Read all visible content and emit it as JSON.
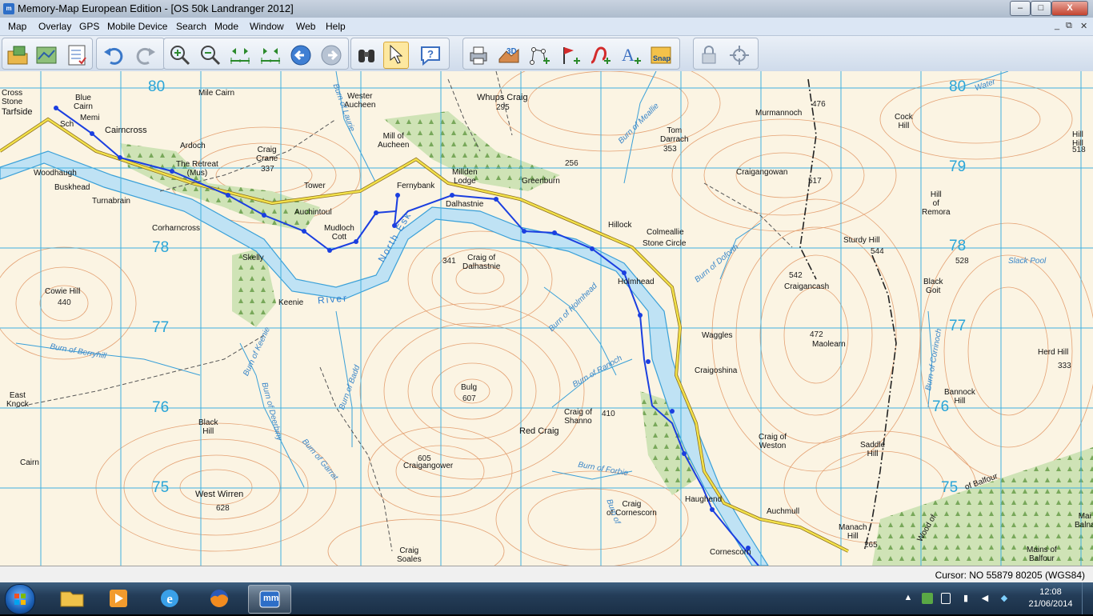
{
  "window": {
    "title": "Memory-Map European Edition - [OS 50k Landranger 2012]",
    "app_icon_text": "m",
    "minimize": "–",
    "maximize": "□",
    "close": "X"
  },
  "menu": {
    "items": [
      "Map",
      "Overlay",
      "GPS",
      "Mobile Device",
      "Search",
      "Mode",
      "Window",
      "Web",
      "Help"
    ],
    "mdi_minimize": "_",
    "mdi_restore": "⧉",
    "mdi_close": "✕"
  },
  "map": {
    "grid_eastings_labels": [
      "80",
      "79",
      "78",
      "77",
      "76",
      "75"
    ],
    "grid_labels_left": [
      "80",
      "78",
      "77",
      "76",
      "75"
    ],
    "grid_labels_right": [
      "80",
      "79",
      "78",
      "77",
      "76",
      "75"
    ],
    "places": {
      "tarfside": "Tarfside",
      "cross_stone": "Cross\nStone",
      "blue_cairn": "Blue\nCairn",
      "memi": "Memi",
      "sch": "Sch",
      "cairncross": "Cairncross",
      "ardoch": "Ardoch",
      "the_retreat": "The Retreat\n(Mus)",
      "woodhaugh": "Woodhaugh",
      "buskhead": "Buskhead",
      "turnabrain": "Turnabrain",
      "craig_crane": "Craig\nCrane",
      "tower": "Tower",
      "auchintoul": "Auchintoul",
      "mudloch_cott": "Mudloch\nCott",
      "corharncross": "Corharncross",
      "skelly": "Skelly",
      "cowie_hill": "Cowie Hill",
      "keenie": "Keenie",
      "mile_cairn": "Mile Cairn",
      "wester_aucheen": "Wester\nAucheen",
      "mill_of_aucheen": "Mill of\nAucheen",
      "whups_craig": "Whups Craig",
      "millden_lodge": "Millden\nLodge",
      "fernybank": "Fernybank",
      "greenburn": "Greenburn",
      "dalhastnie": "Dalhastnie",
      "craig_of_dalhastnie": "Craig of\nDalhastnie",
      "tom_darrach": "Tom\nDarrach",
      "hillock": "Hillock",
      "colmeallie": "Colmeallie",
      "stone_circle": "Stone Circle",
      "holmhead": "Holmhead",
      "murmannoch": "Murmannoch",
      "craigangowan": "Craigangowan",
      "cock_hill": "Cock\nHill",
      "hill_of_remora": "Hill\nof\nRemora",
      "sturdy_hill": "Sturdy Hill",
      "craigancash": "Craigancash",
      "black_goit": "Black\nGoit",
      "slack_pool": "Slack\nPool",
      "hill_of_edzell": "Hill\nHill",
      "maolearn": "Maolearn",
      "waggles": "Waggles",
      "craigoshina": "Craigoshina",
      "herd_hill": "Herd Hill",
      "bannock_hill": "Bannock\nHill",
      "bulg": "Bulg",
      "craig_of_shanno": "Craig of\nShanno",
      "red_craig": "Red Craig",
      "craig_of_weston": "Craig of\nWeston",
      "saddle_hill": "Saddle\nHill",
      "east_knock": "East\nKnock",
      "black_hill": "Black\nHill",
      "cairn": "Cairn",
      "west_wirren": "West Wirren",
      "craigangower": "Craigangower",
      "craig_of_cornescorn": "Craig\nof Cornescorn",
      "haughend": "Haughend",
      "auchmull": "Auchmull",
      "manach_hill": "Manach\nHill",
      "mains_of_balfour": "Mains of\nBalfour",
      "craig_soales": "Craig\nSoales",
      "cornescorn": "Cornescorn",
      "wood_of_balfour": "Wood of",
      "balfour": "of Balfour",
      "mains_balna": "Mai\nBalna"
    },
    "heights": {
      "h295": "295",
      "h337": "337",
      "h440": "440",
      "h256": "256",
      "h353": "353",
      "h341": "341",
      "h476": "476",
      "h517": "517",
      "h544": "544",
      "h528": "528",
      "h542": "542",
      "h472": "472",
      "h333": "333",
      "h607": "607",
      "h410": "410",
      "h605": "605",
      "h628": "628",
      "h265": "265",
      "h518": "518"
    },
    "water": {
      "burn_of_laurie": "Burn of Laurie",
      "burn_of_mealie": "Burn of Meallie",
      "burn_of_berryhill": "Burn of Berryhill",
      "burn_of_keenie": "Burn of Keenie",
      "burn_of_deerbiny": "Burn of Deerbiny",
      "burn_of_badd": "Burn of Badd",
      "burn_of_garrat": "Burn of Garrat",
      "burn_of_holmhead": "Burn of Holmhead",
      "burn_of_ranoch": "Burn of Ranoch",
      "burn_of_forbie": "Burn of Forbie",
      "burn_of_corrnoch": "Burn of Corrinoch",
      "burn_of_doforth": "Burn of Doforth",
      "water": "Water",
      "river": "River",
      "north_esk": "North Esk",
      "burn_of": "Burn of"
    }
  },
  "status": {
    "cursor_readout": "Cursor: NO 55879 80205 (WGS84)"
  },
  "taskbar": {
    "clock_time": "12:08",
    "clock_date": "21/06/2014",
    "mm_label": "mm"
  }
}
